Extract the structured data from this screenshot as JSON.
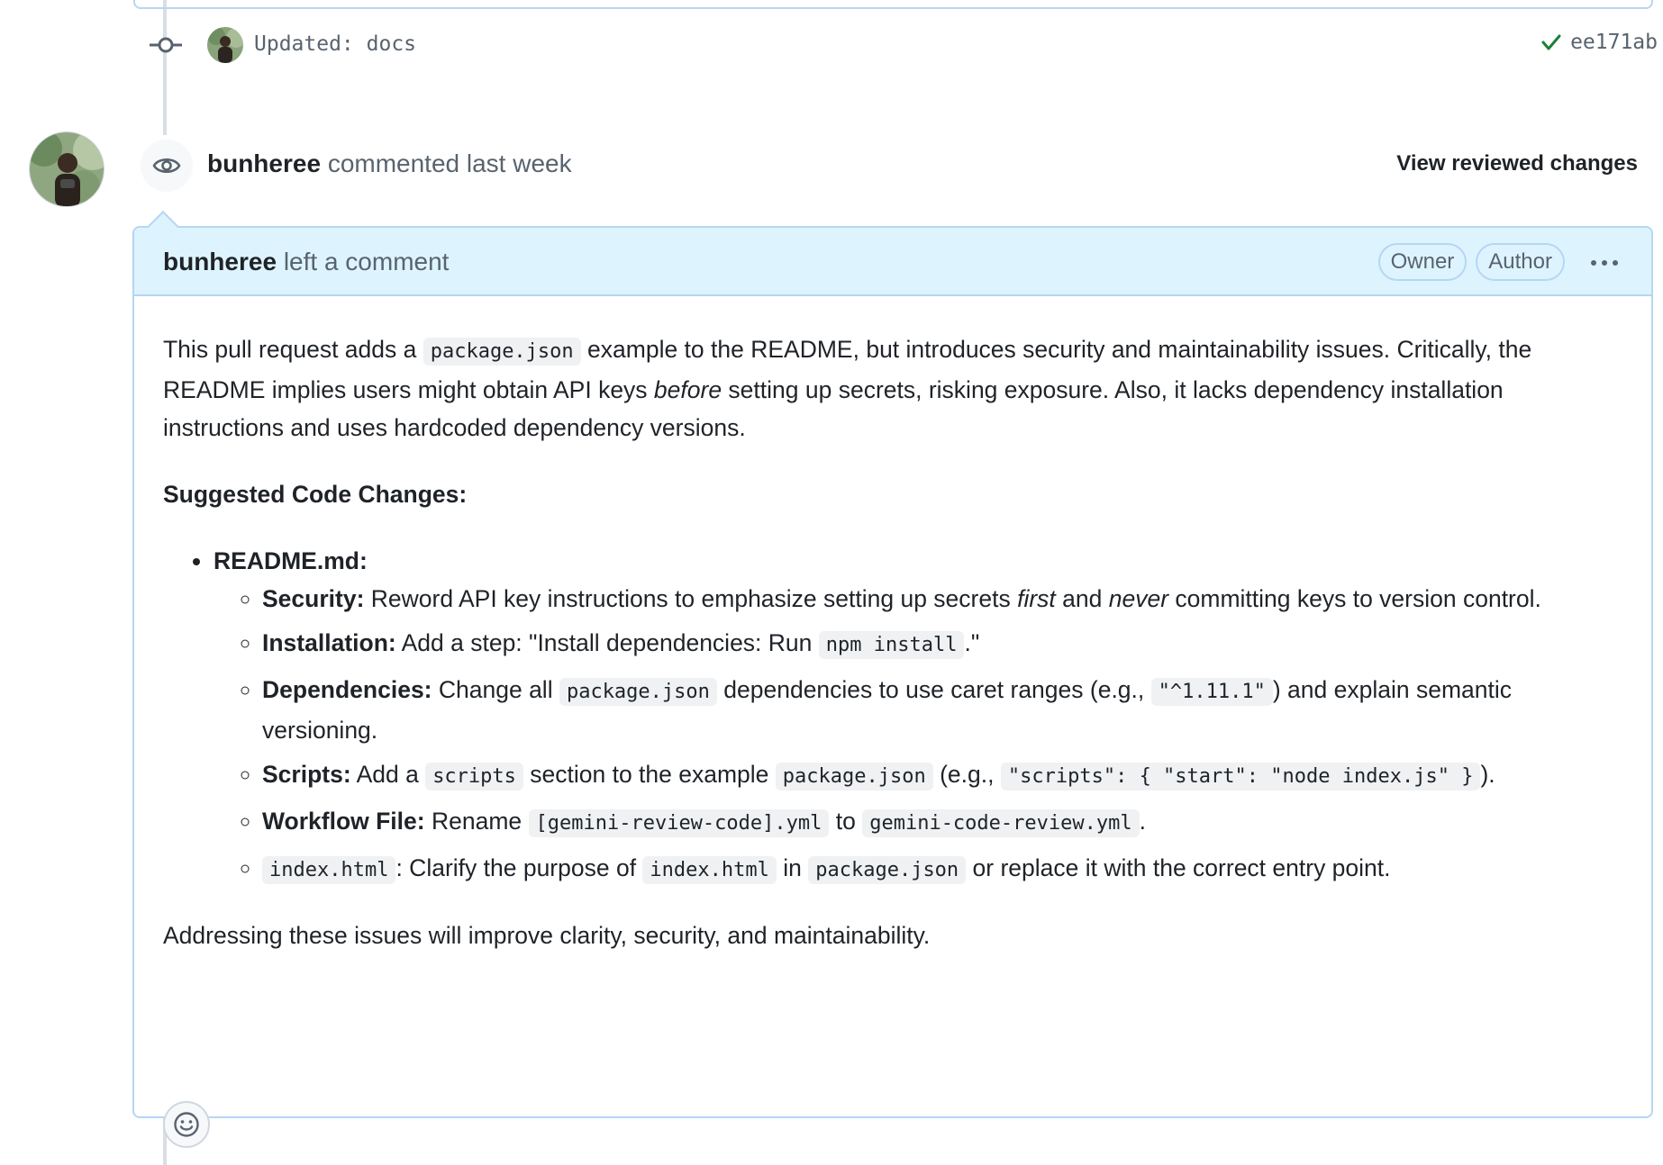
{
  "commit": {
    "message": "Updated: docs",
    "sha": "ee171ab",
    "status_icon": "check-icon",
    "status_color": "#1a7f37"
  },
  "review": {
    "author": "bunheree",
    "action": "commented last week",
    "view_changes_label": "View reviewed changes",
    "icon": "eye-icon"
  },
  "comment": {
    "author": "bunheree",
    "action": "left a comment",
    "labels": [
      "Owner",
      "Author"
    ],
    "menu_icon": "kebab-horizontal-icon",
    "intro": {
      "t1": "This pull request adds a ",
      "c1": "package.json",
      "t2": " example to the README, but introduces security and maintainability issues. Critically, the README implies users might obtain API keys ",
      "em1": "before",
      "t3": " setting up secrets, risking exposure. Also, it lacks dependency installation instructions and uses hardcoded dependency versions."
    },
    "heading": "Suggested Code Changes:",
    "file": "README.md:",
    "items": {
      "security": {
        "label": "Security:",
        "t1": " Reword API key instructions to emphasize setting up secrets ",
        "em1": "first",
        "t2": " and ",
        "em2": "never",
        "t3": " committing keys to version control."
      },
      "installation": {
        "label": "Installation:",
        "t1": " Add a step: \"Install dependencies: Run ",
        "c1": "npm install",
        "t2": ".\""
      },
      "dependencies": {
        "label": "Dependencies:",
        "t1": " Change all ",
        "c1": "package.json",
        "t2": " dependencies to use caret ranges (e.g., ",
        "c2": "\"^1.11.1\"",
        "t3": ") and explain semantic versioning."
      },
      "scripts": {
        "label": "Scripts:",
        "t1": " Add a ",
        "c1": "scripts",
        "t2": " section to the example ",
        "c2": "package.json",
        "t3": " (e.g., ",
        "c3": "\"scripts\": { \"start\": \"node index.js\" }",
        "t4": ")."
      },
      "workflow": {
        "label": "Workflow File:",
        "t1": " Rename ",
        "c1": "[gemini-review-code].yml",
        "t2": " to ",
        "c2": "gemini-code-review.yml",
        "t3": "."
      },
      "index": {
        "c1": "index.html",
        "t1": ": Clarify the purpose of ",
        "c2": "index.html",
        "t2": " in ",
        "c3": "package.json",
        "t3": " or replace it with the correct entry point."
      }
    },
    "closing": "Addressing these issues will improve clarity, security, and maintainability.",
    "reaction_icon": "smiley-icon"
  },
  "colors": {
    "accent_border": "#b6d6f3",
    "header_bg": "#ddf4ff",
    "muted_text": "#59636e"
  }
}
